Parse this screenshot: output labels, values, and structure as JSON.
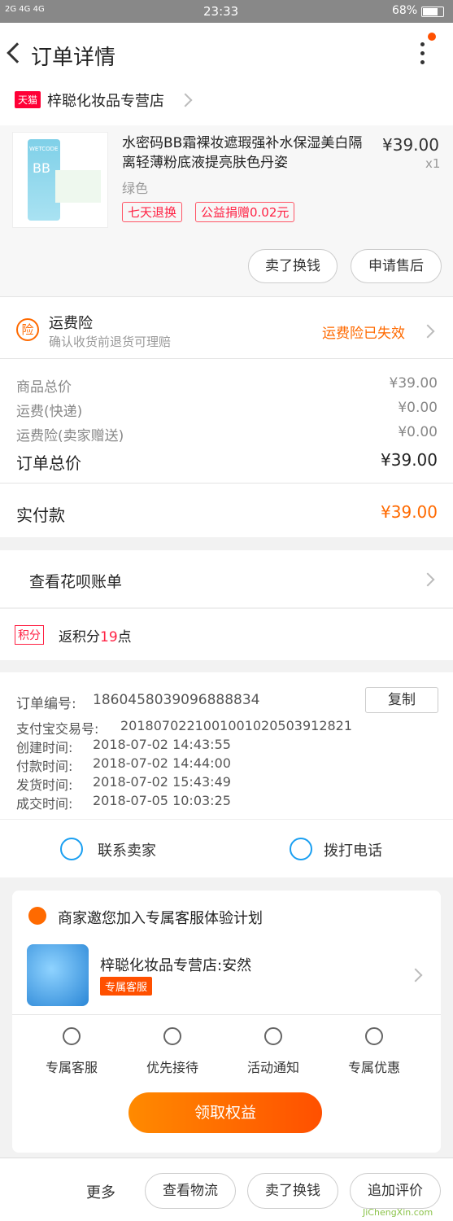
{
  "status_bar": {
    "signal": "2G 4G 4G",
    "time": "23:33",
    "battery": "68%"
  },
  "header": {
    "title": "订单详情"
  },
  "shop": {
    "badge": "天猫",
    "name": "梓聪化妆品专营店"
  },
  "product": {
    "title": "水密码BB霜裸妆遮瑕强补水保湿美白隔离轻薄粉底液提亮肤色丹姿",
    "variant": "绿色",
    "price": "¥39.00",
    "qty": "x1",
    "tag_return": "七天退换",
    "tag_charity": "公益捐赠0.02元",
    "image_brand": "WETCODE",
    "image_bb": "BB"
  },
  "actions": {
    "sell_again": "卖了换钱",
    "after_sale": "申请售后"
  },
  "insurance": {
    "icon": "险",
    "title": "运费险",
    "subtitle": "确认收货前退货可理赔",
    "status": "运费险已失效"
  },
  "totals": [
    {
      "label": "商品总价",
      "value": "¥39.00"
    },
    {
      "label": "运费(快递)",
      "value": "¥0.00"
    },
    {
      "label": "运费险(卖家赠送)",
      "value": "¥0.00"
    }
  ],
  "order_total": {
    "label": "订单总价",
    "value": "¥39.00"
  },
  "paid": {
    "label": "实付款",
    "value": "¥39.00"
  },
  "huabei": {
    "label": "查看花呗账单"
  },
  "points": {
    "badge": "积分",
    "prefix": "返积分",
    "num": "19",
    "suffix": "点"
  },
  "order_info": {
    "order_no_label": "订单编号:",
    "order_no": "1860458039096888834",
    "copy_label": "复制",
    "lines": [
      {
        "label": "支付宝交易号:",
        "value": "2018070221001001020503912821"
      },
      {
        "label": "创建时间:",
        "value": "2018-07-02 14:43:55"
      },
      {
        "label": "付款时间:",
        "value": "2018-07-02 14:44:00"
      },
      {
        "label": "发货时间:",
        "value": "2018-07-02 15:43:49"
      },
      {
        "label": "成交时间:",
        "value": "2018-07-05 10:03:25"
      }
    ]
  },
  "contact": {
    "seller": "联系卖家",
    "call": "拨打电话"
  },
  "vip": {
    "headline": "商家邀您加入专属客服体验计划",
    "shop_agent": "梓聪化妆品专营店:安然",
    "badge": "专属客服",
    "features": [
      "专属客服",
      "优先接待",
      "活动通知",
      "专属优惠"
    ],
    "cta": "领取权益"
  },
  "bottom_bar": {
    "more": "更多",
    "logistics": "查看物流",
    "sell": "卖了换钱",
    "review": "追加评价"
  },
  "watermark": {
    "text": "JiChengXin.com"
  }
}
